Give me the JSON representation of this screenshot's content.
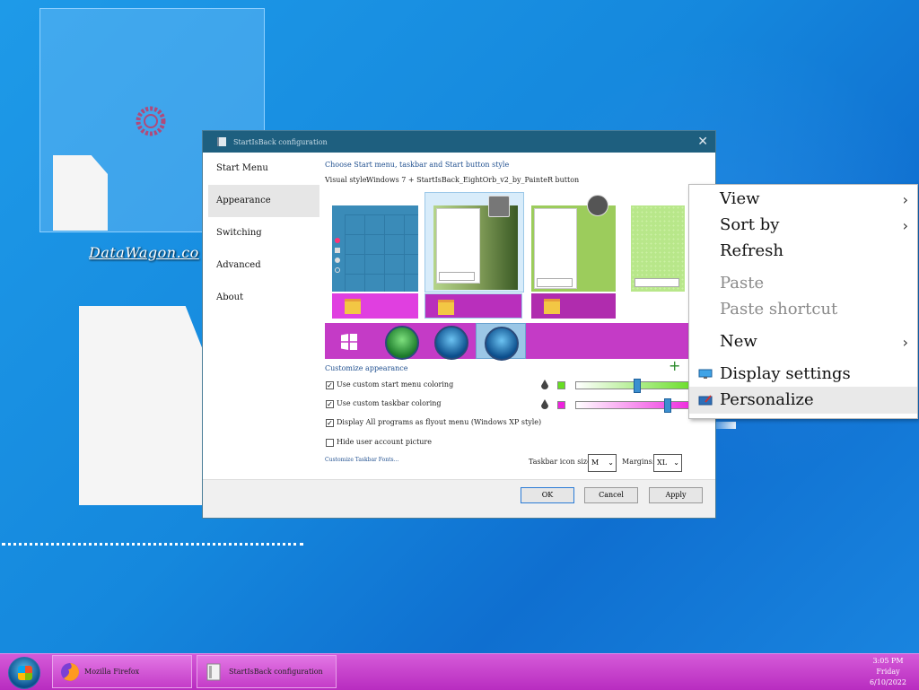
{
  "desktop": {
    "label": "DataWagon.co"
  },
  "window": {
    "title": "StartIsBack configuration",
    "nav": [
      "Start Menu",
      "Appearance",
      "Switching",
      "Advanced",
      "About"
    ],
    "active_nav": "Appearance",
    "heading": "Choose Start menu, taskbar and Start button style",
    "visual_style_label": "Visual style:",
    "visual_style_value": "Windows 7 + StartIsBack_EightOrb_v2_by_PainteR button",
    "customize_heading": "Customize appearance",
    "options": [
      {
        "label": "Use custom start menu coloring",
        "checked": true
      },
      {
        "label": "Use custom taskbar coloring",
        "checked": true
      },
      {
        "label": "Display All programs as flyout menu (Windows XP style)",
        "checked": true
      },
      {
        "label": "Hide user account picture",
        "checked": false
      }
    ],
    "customize_link": "Customize Taskbar Fonts...",
    "taskbar_icon_size_label": "Taskbar icon size:",
    "taskbar_icon_size_value": "M",
    "margins_label": "Margins:",
    "margins_value": "XL",
    "buttons": {
      "ok": "OK",
      "cancel": "Cancel",
      "apply": "Apply"
    },
    "colors": {
      "start_menu": "#66dd22",
      "taskbar": "#ee22dd"
    },
    "slider_levels": {
      "start_menu": 0.5,
      "taskbar": 0.77
    }
  },
  "context_menu": {
    "items": [
      {
        "label": "View",
        "submenu": true,
        "disabled": false
      },
      {
        "label": "Sort by",
        "submenu": true,
        "disabled": false
      },
      {
        "label": "Refresh",
        "submenu": false,
        "disabled": false
      },
      {
        "label": "Paste",
        "submenu": false,
        "disabled": true
      },
      {
        "label": "Paste shortcut",
        "submenu": false,
        "disabled": true
      },
      {
        "label": "New",
        "submenu": true,
        "disabled": false
      },
      {
        "label": "Display settings",
        "submenu": false,
        "disabled": false,
        "icon": "display-icon"
      },
      {
        "label": "Personalize",
        "submenu": false,
        "disabled": false,
        "icon": "personalize-icon",
        "highlighted": true
      }
    ],
    "submenu_glyph": "›"
  },
  "taskbar": {
    "tasks": [
      {
        "label": "Mozilla Firefox",
        "icon": "firefox-icon"
      },
      {
        "label": "StartIsBack configuration",
        "icon": "config-icon"
      }
    ],
    "clock": {
      "time": "3:05 PM",
      "day": "Friday",
      "date": "6/10/2022"
    }
  }
}
